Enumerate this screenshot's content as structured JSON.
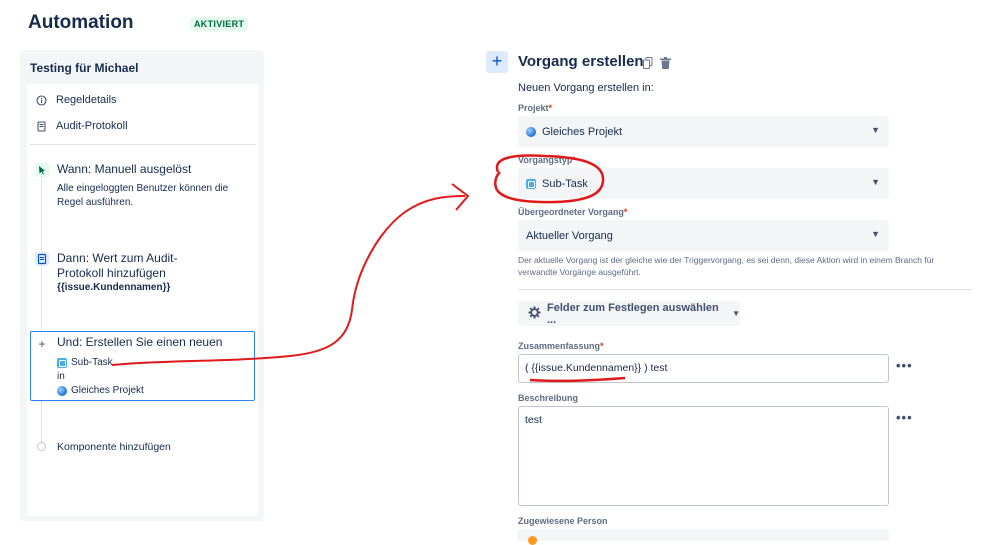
{
  "header": {
    "title": "Automation",
    "status_badge": "AKTIVIERT"
  },
  "rule": {
    "name": "Testing für Michael",
    "nav": [
      {
        "label": "Regeldetails",
        "icon": "info-icon"
      },
      {
        "label": "Audit-Protokoll",
        "icon": "document-icon"
      }
    ],
    "trigger": {
      "title": "Wann: Manuell ausgelöst",
      "desc_line1": "Alle eingeloggten Benutzer können die",
      "desc_line2": "Regel ausführen.",
      "icon": "cursor-icon"
    },
    "action1": {
      "title_line1": "Dann: Wert zum Audit-",
      "title_line2": "Protokoll hinzufügen",
      "value": "{{issue.Kundennamen}}",
      "icon": "log-icon"
    },
    "action2": {
      "title": "Und: Erstellen Sie einen neuen",
      "issue_type": "Sub-Task",
      "in": "in",
      "project": "Gleiches Projekt",
      "icon": "plus-icon"
    },
    "add_component": "Komponente hinzufügen"
  },
  "editor": {
    "title": "Vorgang erstellen",
    "subtitle": "Neuen Vorgang erstellen in:",
    "project_label": "Projekt",
    "project_value": "Gleiches Projekt",
    "type_label": "Vorgangstyp",
    "type_value": "Sub-Task",
    "parent_label": "Übergeordneter Vorgang",
    "parent_value": "Aktueller Vorgang",
    "help_line1": "Der aktuelle Vorgang ist der gleiche wie der Triggervorgang, es sei denn, diese Aktion wird in einem Branch für",
    "help_line2": "verwandte Vorgänge ausgeführt.",
    "fields_button": "Felder zum Festlegen auswählen ...",
    "summary_label": "Zusammenfassung",
    "summary_value": "( {{issue.Kundennamen}} ) test",
    "description_label": "Beschreibung",
    "description_value": "test",
    "assignee_label": "Zugewiesene Person",
    "required_mark": "*",
    "more": "•••"
  },
  "colors": {
    "accent": "#0052cc",
    "annotation": "#e0191b",
    "status": "#006644"
  }
}
